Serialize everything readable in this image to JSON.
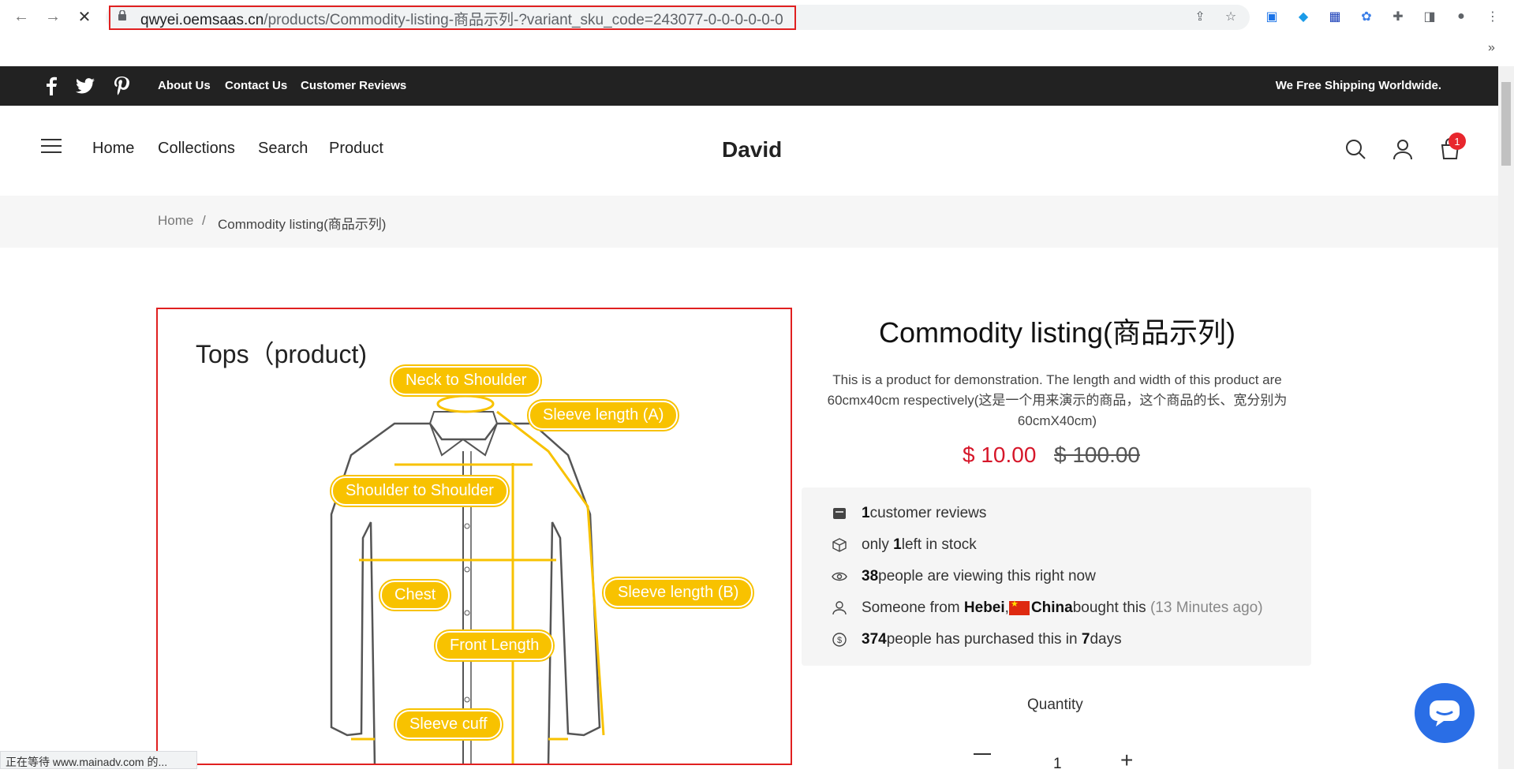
{
  "browser": {
    "url_host": "qwyei.oemsaas.cn",
    "url_path": "/products/Commodity-listing-商品示列-?variant_sku_code=243077-0-0-0-0-0-0",
    "overflow": "»",
    "status_text": "正在等待 www.mainadv.com 的..."
  },
  "topbar": {
    "links": [
      "About Us",
      "Contact Us",
      "Customer Reviews"
    ],
    "shipping": "We Free Shipping Worldwide."
  },
  "header": {
    "menu": [
      "Home",
      "Collections",
      "Search",
      "Product"
    ],
    "brand": "David",
    "cart_count": "1"
  },
  "breadcrumb": {
    "home": "Home",
    "sep": "/",
    "current": "Commodity listing(商品示列)"
  },
  "image": {
    "heading": "Tops（product)",
    "tags": [
      "Neck to Shoulder",
      "Sleeve length (A)",
      "Shoulder to Shoulder",
      "Chest",
      "Sleeve length (B)",
      "Front Length",
      "Sleeve cuff"
    ],
    "tag_color": "#f8c200"
  },
  "product": {
    "title": "Commodity listing(商品示列)",
    "description": "This is a product for demonstration. The length and width of this product are 60cmx40cm respectively(这是一个用来演示的商品，这个商品的长、宽分别为60cmX40cm)",
    "price": "$ 10.00",
    "old_price": "$ 100.00",
    "price_color": "#d6172a"
  },
  "info": {
    "reviews_count": "1",
    "reviews_text": " customer reviews",
    "stock_pre": "only ",
    "stock_count": "1",
    "stock_post": " left in stock",
    "viewing_count": "38",
    "viewing_text": " people are viewing this right now",
    "someone_pre": "Someone from ",
    "someone_city": "Hebei",
    "someone_comma": ", ",
    "someone_country": "China",
    "someone_post": " bought this ",
    "someone_time": "(13 Minutes ago)",
    "purchased_count": "374",
    "purchased_mid": " people has purchased this in ",
    "purchased_days": "7",
    "purchased_post": " days"
  },
  "quantity": {
    "label": "Quantity",
    "value": "1"
  }
}
